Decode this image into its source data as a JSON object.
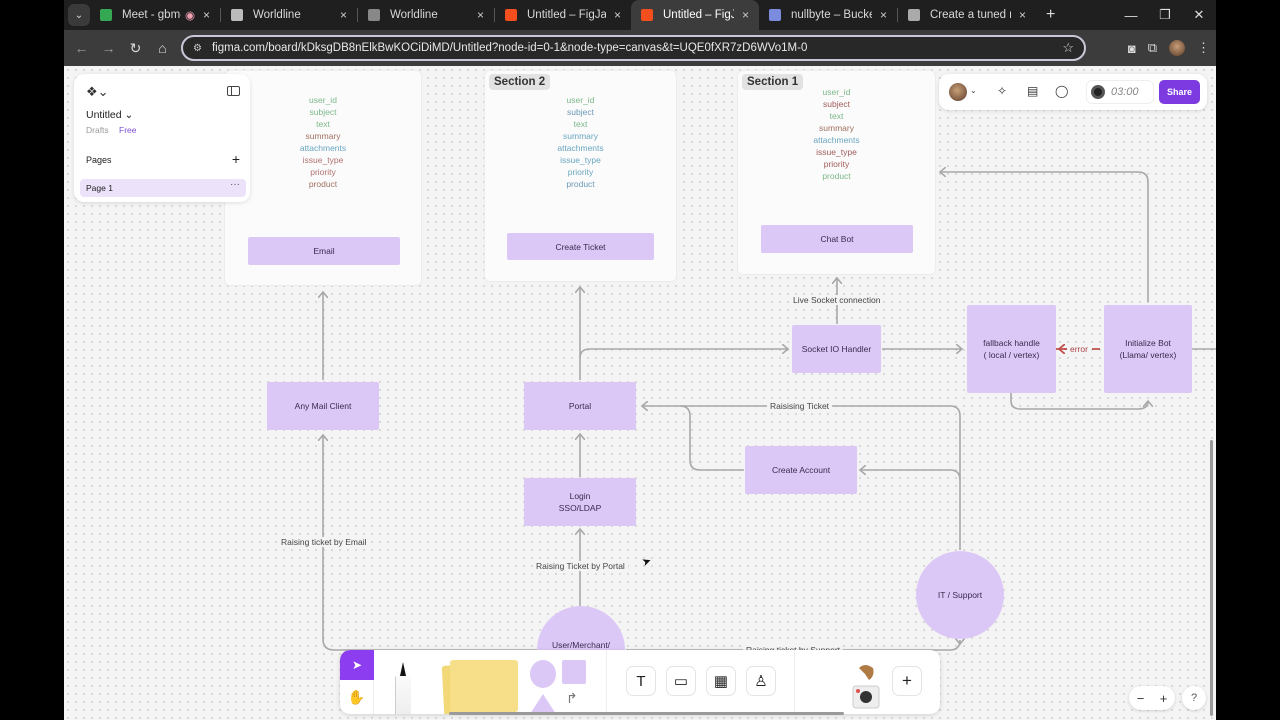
{
  "browser": {
    "tabs": [
      {
        "title": "Meet - gbm-nuv",
        "icon": "google-meet-icon",
        "favcolor": "#34a853",
        "recording": true
      },
      {
        "title": "Worldline",
        "icon": "globe-icon",
        "favcolor": "#bbbbbb"
      },
      {
        "title": "Worldline",
        "icon": "cloud-icon",
        "favcolor": "#888888"
      },
      {
        "title": "Untitled – FigJam",
        "icon": "figma-icon",
        "favcolor": "#f24e1e"
      },
      {
        "title": "Untitled – FigJam",
        "icon": "figma-icon",
        "favcolor": "#f24e1e",
        "active": true
      },
      {
        "title": "nullbyte – Bucket de",
        "icon": "bucket-icon",
        "favcolor": "#7b8cde"
      },
      {
        "title": "Create a tuned mode",
        "icon": "vertex-icon",
        "favcolor": "#aaaaaa"
      }
    ],
    "url": "figma.com/board/kDksgDB8nElkBwKOCiDiMD/Untitled?node-id=0-1&node-type=canvas&t=UQE0fXR7zD6WVo1M-0",
    "newtab": "+",
    "close": "×"
  },
  "file_panel": {
    "file_name": "Untitled",
    "location": "Drafts",
    "plan": "Free",
    "pages_heading": "Pages",
    "add_page": "+",
    "pages": [
      {
        "label": "Page 1",
        "more": "···"
      }
    ]
  },
  "header": {
    "timer": "03:00",
    "share_label": "Share"
  },
  "sections": [
    {
      "label": "",
      "action": "Email",
      "fields": [
        {
          "text": "user_id",
          "color": "#7cb88a"
        },
        {
          "text": "subject",
          "color": "#7cb88a"
        },
        {
          "text": "text",
          "color": "#7cb88a"
        },
        {
          "text": "summary",
          "color": "#a07060"
        },
        {
          "text": "attachments",
          "color": "#6aa6c0"
        },
        {
          "text": "issue_type",
          "color": "#b07070"
        },
        {
          "text": "priority",
          "color": "#b07070"
        },
        {
          "text": "product",
          "color": "#a07060"
        }
      ]
    },
    {
      "label": "Section 2",
      "action": "Create Ticket",
      "fields": [
        {
          "text": "user_id",
          "color": "#7cb88a"
        },
        {
          "text": "subject",
          "color": "#6a9ab8"
        },
        {
          "text": "text",
          "color": "#7cb88a"
        },
        {
          "text": "summary",
          "color": "#6aa6c0"
        },
        {
          "text": "attachments",
          "color": "#6aa6c0"
        },
        {
          "text": "issue_type",
          "color": "#6aa6c0"
        },
        {
          "text": "priority",
          "color": "#6aa6c0"
        },
        {
          "text": "product",
          "color": "#6a9ab8"
        }
      ]
    },
    {
      "label": "Section 1",
      "action": "Chat Bot",
      "fields": [
        {
          "text": "user_id",
          "color": "#7cb88a"
        },
        {
          "text": "subject",
          "color": "#a05a5a"
        },
        {
          "text": "text",
          "color": "#7cb88a"
        },
        {
          "text": "summary",
          "color": "#a07060"
        },
        {
          "text": "attachments",
          "color": "#6aa6c0"
        },
        {
          "text": "issue_type",
          "color": "#a05a5a"
        },
        {
          "text": "priority",
          "color": "#a05a5a"
        },
        {
          "text": "product",
          "color": "#7cb88a"
        }
      ]
    }
  ],
  "nodes": {
    "mail_client": "Any Mail Client",
    "portal": "Portal",
    "login": "Login\nSSO/LDAP",
    "socket": "Socket IO Handler",
    "fallback": "fallback handle\n( local / vertex)",
    "init_bot": "Initialize Bot\n(Llama/ vertex)",
    "create_account": "Create Account",
    "it_support": "IT / Support",
    "user": "User/Merchant/"
  },
  "edge_labels": {
    "live_socket": "Live Socket connection",
    "error": "error",
    "raising_ticket": "Raisising Ticket",
    "by_email": "Raising ticket by Email",
    "by_portal": "Raising Ticket by Portal",
    "by_support": "Raising ticket by Support"
  },
  "zoom_controls": {
    "minus": "−",
    "plus": "+",
    "help": "?"
  },
  "colors": {
    "accent": "#8c3df0",
    "node": "#dcc8f6",
    "share": "#7c3ae0",
    "connector": "#a8a8a8",
    "error": "#c0504d"
  }
}
